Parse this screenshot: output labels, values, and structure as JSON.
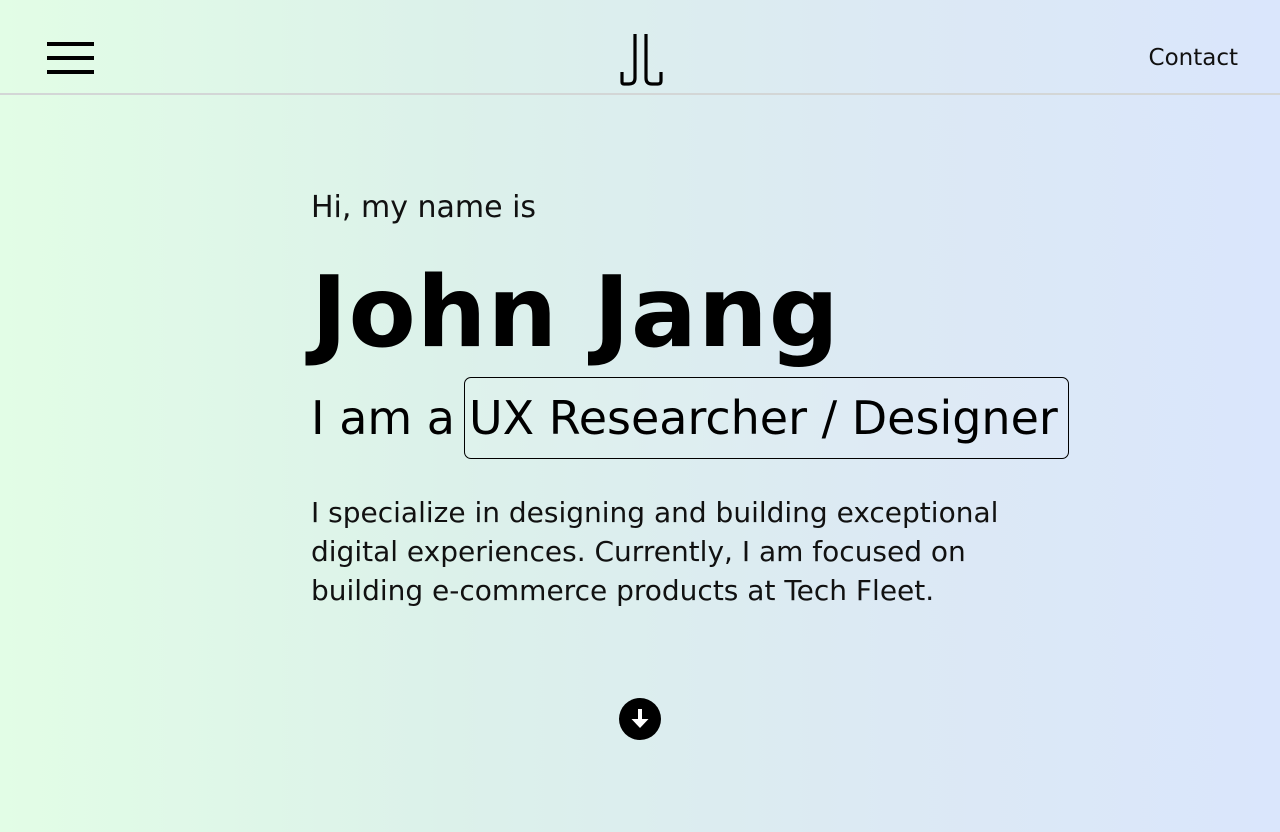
{
  "header": {
    "menu_icon": "hamburger-menu-icon",
    "logo_icon": "jj-monogram-logo",
    "contact_label": "Contact"
  },
  "hero": {
    "greeting": "Hi, my name is",
    "name": "John Jang",
    "role_prefix": "I am a",
    "role": "UX Researcher / Designer",
    "bio": "I specialize in designing and building exceptional digital experiences. Currently, I am focused on building e-commerce products at Tech Fleet."
  },
  "scroll": {
    "icon": "arrow-down-circle-icon"
  },
  "colors": {
    "gradient_start": "#e2fde6",
    "gradient_end": "#dae6fc",
    "text": "#000000",
    "divider": "#d3d6d6"
  }
}
